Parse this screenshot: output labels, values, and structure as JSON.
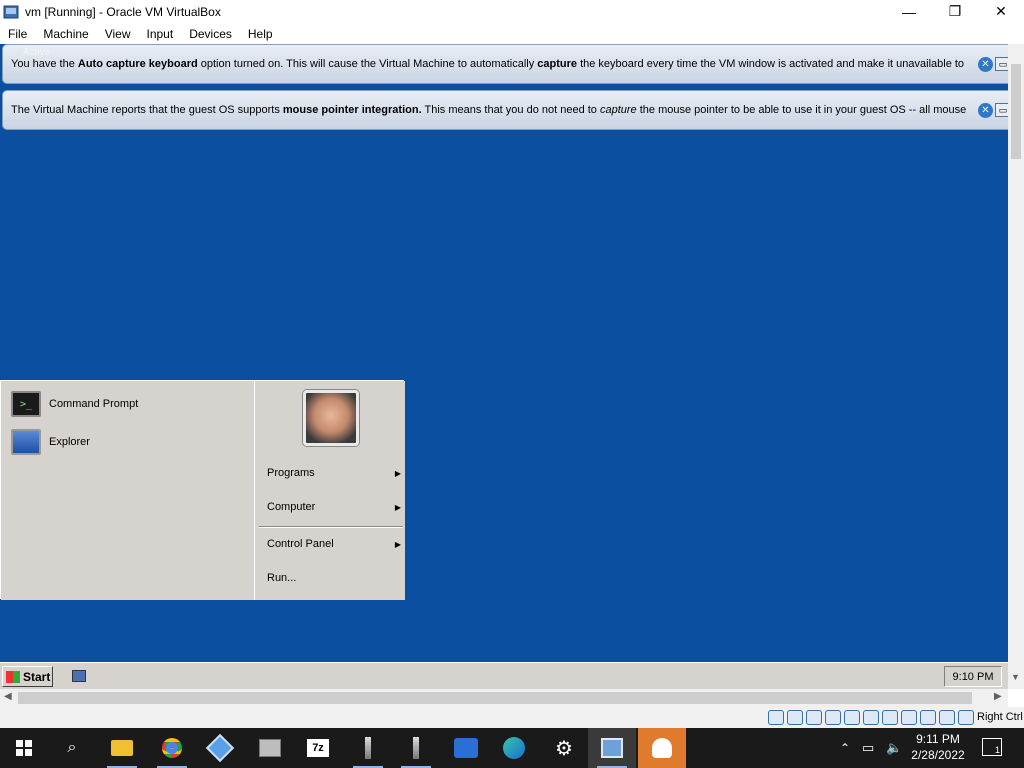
{
  "window": {
    "title": "vm [Running] - Oracle VM VirtualBox",
    "minimize": "—",
    "restore": "❐",
    "close": "✕"
  },
  "menu": [
    "File",
    "Machine",
    "View",
    "Input",
    "Devices",
    "Help"
  ],
  "vm": {
    "active_label": "Active",
    "notice1": {
      "p1": "You have the ",
      "b1": "Auto capture keyboard",
      "p2": " option turned on. This will cause the Virtual Machine to automatically ",
      "b2": "capture",
      "p3": " the keyboard every time the VM window is activated and make it unavailable to"
    },
    "notice2": {
      "p1": "The Virtual Machine reports that the guest OS supports ",
      "b1": "mouse pointer integration.",
      "p2": " This means that you do not need to ",
      "i1": "capture",
      "p3": " the mouse pointer to be able to use it in your guest OS -- all mouse"
    },
    "start_menu": {
      "left_items": [
        "Command Prompt",
        "Explorer"
      ],
      "right_items": [
        {
          "label": "Programs",
          "submenu": true
        },
        {
          "label": "Computer",
          "submenu": true
        },
        {
          "label": "Control Panel",
          "submenu": true
        },
        {
          "label": "Run...",
          "submenu": false
        }
      ]
    },
    "taskbar": {
      "start_label": "Start",
      "clock": "9:10 PM"
    }
  },
  "statusbar": {
    "host_key": "Right Ctrl"
  },
  "host_taskbar": {
    "time": "9:11 PM",
    "date": "2/28/2022",
    "notifications": "1",
    "icons": [
      "windows-start-icon",
      "search-icon",
      "file-explorer-icon",
      "chrome-icon",
      "virtualbox-icon",
      "app-icon",
      "7zip-icon",
      "app-icon",
      "app-icon",
      "app-icon",
      "edge-icon",
      "settings-icon",
      "vm-icon",
      "person-icon"
    ]
  }
}
